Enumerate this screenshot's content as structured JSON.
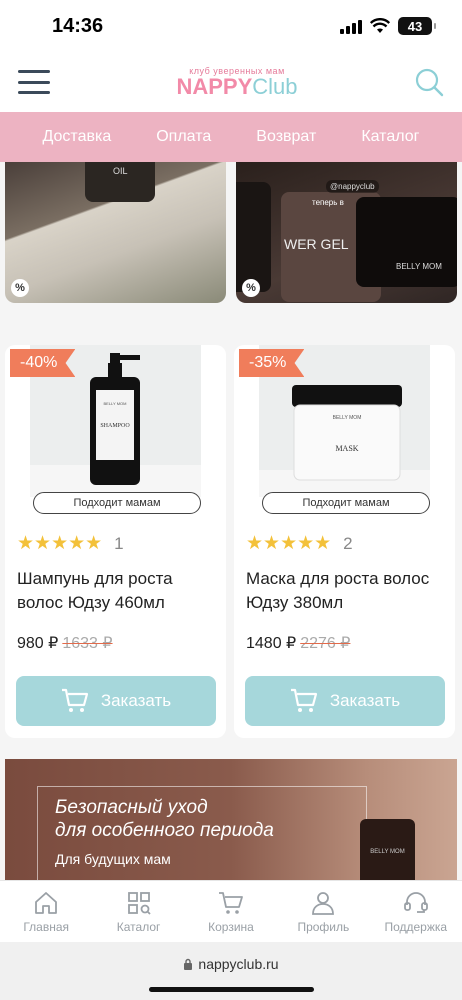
{
  "status": {
    "time": "14:36",
    "battery": "43"
  },
  "header": {
    "logo_tag": "клуб уверенных мам",
    "logo_main_a": "NAPPY",
    "logo_main_b": "Club"
  },
  "nav": [
    "Доставка",
    "Оплата",
    "Возврат",
    "Каталог"
  ],
  "promos": [
    {
      "badge": "%",
      "text": "OIL"
    },
    {
      "badge": "%",
      "text": "WER GEL",
      "handle": "@nappyclub",
      "caption": "теперь в",
      "brand": "BELLY MOM"
    }
  ],
  "products": [
    {
      "discount": "-40%",
      "fits": "Подходит мамам",
      "stars": "★★★★★",
      "reviews": "1",
      "name": "Шампунь для роста волос Юдзу 460мл",
      "price": "980 ₽",
      "old_price": "1633 ₽",
      "button": "Заказать",
      "label": "SHAMPOO",
      "brand": "BELLY MOM"
    },
    {
      "discount": "-35%",
      "fits": "Подходит мамам",
      "stars": "★★★★★",
      "reviews": "2",
      "name": "Маска для роста волос Юдзу 380мл",
      "price": "1480 ₽",
      "old_price": "2276 ₽",
      "button": "Заказать",
      "label": "MASK",
      "brand": "BELLY MOM"
    }
  ],
  "banner": {
    "title_line1": "Безопасный уход",
    "title_line2": "для особенного периода",
    "subtitle": "Для будущих мам",
    "bottle_brand": "BELLY MOM"
  },
  "tabbar": [
    {
      "label": "Главная",
      "icon": "home-icon"
    },
    {
      "label": "Каталог",
      "icon": "catalog-icon"
    },
    {
      "label": "Корзина",
      "icon": "cart-icon"
    },
    {
      "label": "Профиль",
      "icon": "profile-icon"
    },
    {
      "label": "Поддержка",
      "icon": "support-icon"
    }
  ],
  "browser": {
    "url": "nappyclub.ru"
  },
  "colors": {
    "nav_pink": "#edb3c2",
    "button_teal": "#a6d7db",
    "discount": "#f07d5b",
    "star": "#f3c13a"
  }
}
